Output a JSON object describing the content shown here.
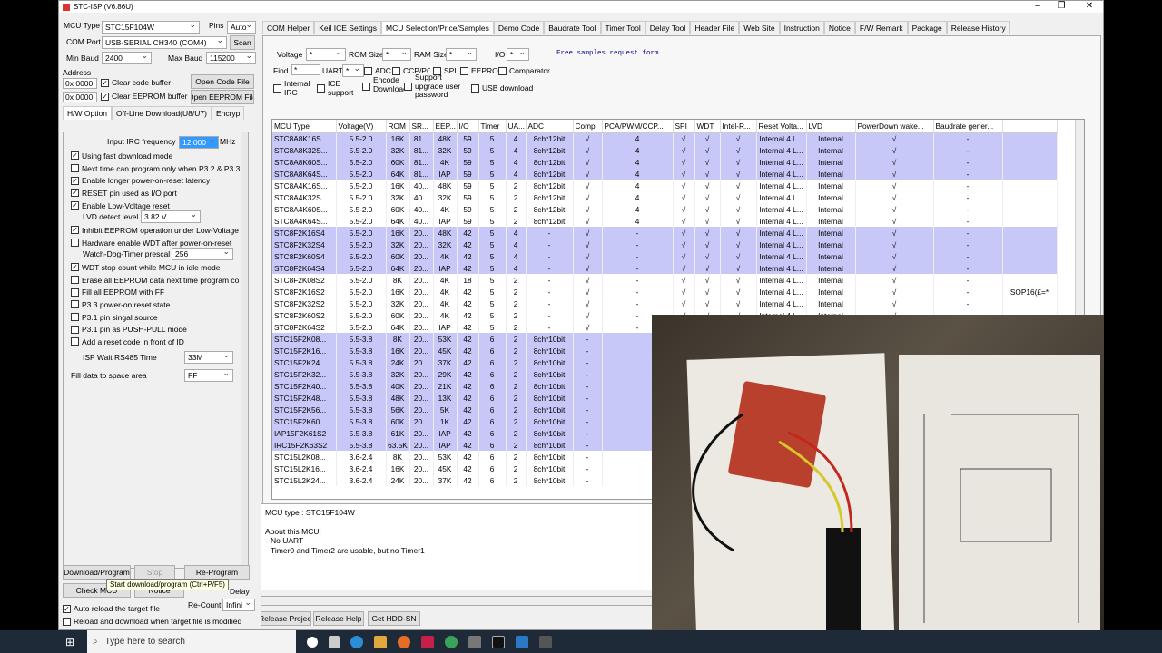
{
  "window": {
    "title": "STC-ISP (V6.86U)"
  },
  "left": {
    "mcu_type_label": "MCU Type",
    "mcu_type": "STC15F104W",
    "pins_label": "Pins",
    "pins": "Auto",
    "com_port_label": "COM Port",
    "com_port": "USB-SERIAL CH340 (COM4)",
    "scan": "Scan",
    "min_baud_label": "Min Baud",
    "min_baud": "2400",
    "max_baud_label": "Max Baud",
    "max_baud": "115200",
    "address_label": "Address",
    "addr1": "0x 0000",
    "addr2": "0x 0000",
    "clear_code_buffer": "Clear code buffer",
    "clear_eeprom_buffer": "Clear EEPROM buffer",
    "open_code_file": "Open Code File",
    "open_eeprom_file": "Open EEPROM File",
    "tabs": [
      "H/W Option",
      "Off-Line Download(U8/U7)",
      "Encryp"
    ],
    "irc_label": "Input IRC frequency",
    "irc_value": "12.000",
    "irc_unit": "MHz",
    "options": [
      {
        "text": "Using fast download mode",
        "checked": true
      },
      {
        "text": "Next time can program only when P3.2 & P3.3",
        "checked": false
      },
      {
        "text": "Enable longer power-on-reset latency",
        "checked": true
      },
      {
        "text": "RESET pin used as I/O port",
        "checked": true
      },
      {
        "text": "Enable Low-Voltage reset",
        "checked": true
      }
    ],
    "lvd_label": "LVD detect level",
    "lvd_value": "3.82 V",
    "options2": [
      {
        "text": "Inhibit EEPROM operation under Low-Voltage",
        "checked": true
      },
      {
        "text": "Hardware enable WDT after power-on-reset",
        "checked": false
      }
    ],
    "wdt_label": "Watch-Dog-Timer prescal",
    "wdt_value": "256",
    "options3": [
      {
        "text": "WDT stop count while MCU in idle mode",
        "checked": true
      },
      {
        "text": "Erase all EEPROM data next time program co",
        "checked": false
      },
      {
        "text": "Fill all EEPROM with FF",
        "checked": false
      },
      {
        "text": "P3.3 power-on reset state",
        "checked": false
      },
      {
        "text": "P3.1 pin singal source",
        "checked": false
      },
      {
        "text": "P3.1 pin as PUSH-PULL mode",
        "checked": false
      },
      {
        "text": "Add a reset code in front of ID",
        "checked": false
      }
    ],
    "isp_wait_label": "ISP Wait RS485 Time",
    "isp_wait_value": "33M",
    "fill_label": "Fill data to space area",
    "fill_value": "FF",
    "download_program": "Download/Program",
    "stop": "Stop",
    "re_program": "Re-Program",
    "check_mcu": "Check MCU",
    "notice": "Notice",
    "delay": "Delay",
    "tooltip": "Start download/program (Ctrl+P/F5)",
    "re_count_label": "Re-Count",
    "re_count_value": "Infini",
    "auto_reload": "Auto reload the target file",
    "reload_download": "Reload and download when target file is modified"
  },
  "right": {
    "tabs": [
      "COM Helper",
      "Keil ICE Settings",
      "MCU Selection/Price/Samples",
      "Demo Code",
      "Baudrate Tool",
      "Timer Tool",
      "Delay Tool",
      "Header File",
      "Web Site",
      "Instruction",
      "Notice",
      "F/W Remark",
      "Package",
      "Release History"
    ],
    "filters": {
      "voltage": "Voltage",
      "rom_size": "ROM Size",
      "ram_size": "RAM Size",
      "io": "I/O",
      "find": "Find",
      "find_value": "*",
      "uart": "UART",
      "star": "*",
      "adc": "ADC",
      "ccp_pca": "CCP/PCA",
      "spi": "SPI",
      "eeprom": "EEPROM",
      "comparator": "Comparator",
      "internal_irc": "Internal IRC",
      "ice_support": "ICE support",
      "encode_download": "Encode Download",
      "support_upgrade": "Support upgrade user password",
      "usb_download": "USB download",
      "free_samples": "Free samples request form"
    },
    "columns": [
      "MCU Type",
      "Voltage(V)",
      "ROM",
      "SR...",
      "EEP...",
      "I/O",
      "Timer",
      "UA...",
      "ADC",
      "Comp",
      "PCA/PWM/CCP...",
      "SPI",
      "WDT",
      "Intel-R...",
      "Reset Volta...",
      "LVD",
      "PowerDown wake...",
      "Baudrate gener..."
    ],
    "rows": [
      [
        "STC8A8K16S...",
        "5.5-2.0",
        "16K",
        "81...",
        "48K",
        "59",
        "5",
        "4",
        "8ch*12bit",
        "√",
        "4",
        "√",
        "√",
        "√",
        "Internal 4 L...",
        "Internal",
        "√",
        "-",
        ""
      ],
      [
        "STC8A8K32S...",
        "5.5-2.0",
        "32K",
        "81...",
        "32K",
        "59",
        "5",
        "4",
        "8ch*12bit",
        "√",
        "4",
        "√",
        "√",
        "√",
        "Internal 4 L...",
        "Internal",
        "√",
        "-",
        ""
      ],
      [
        "STC8A8K60S...",
        "5.5-2.0",
        "60K",
        "81...",
        "4K",
        "59",
        "5",
        "4",
        "8ch*12bit",
        "√",
        "4",
        "√",
        "√",
        "√",
        "Internal 4 L...",
        "Internal",
        "√",
        "-",
        ""
      ],
      [
        "STC8A8K64S...",
        "5.5-2.0",
        "64K",
        "81...",
        "IAP",
        "59",
        "5",
        "4",
        "8ch*12bit",
        "√",
        "4",
        "√",
        "√",
        "√",
        "Internal 4 L...",
        "Internal",
        "√",
        "-",
        ""
      ],
      [
        "STC8A4K16S...",
        "5.5-2.0",
        "16K",
        "40...",
        "48K",
        "59",
        "5",
        "2",
        "8ch*12bit",
        "√",
        "4",
        "√",
        "√",
        "√",
        "Internal 4 L...",
        "Internal",
        "√",
        "-",
        ""
      ],
      [
        "STC8A4K32S...",
        "5.5-2.0",
        "32K",
        "40...",
        "32K",
        "59",
        "5",
        "2",
        "8ch*12bit",
        "√",
        "4",
        "√",
        "√",
        "√",
        "Internal 4 L...",
        "Internal",
        "√",
        "-",
        ""
      ],
      [
        "STC8A4K60S...",
        "5.5-2.0",
        "60K",
        "40...",
        "4K",
        "59",
        "5",
        "2",
        "8ch*12bit",
        "√",
        "4",
        "√",
        "√",
        "√",
        "Internal 4 L...",
        "Internal",
        "√",
        "-",
        ""
      ],
      [
        "STC8A4K64S...",
        "5.5-2.0",
        "64K",
        "40...",
        "IAP",
        "59",
        "5",
        "2",
        "8ch*12bit",
        "√",
        "4",
        "√",
        "√",
        "√",
        "Internal 4 L...",
        "Internal",
        "√",
        "-",
        ""
      ],
      [
        "STC8F2K16S4",
        "5.5-2.0",
        "16K",
        "20...",
        "48K",
        "42",
        "5",
        "4",
        "-",
        "√",
        "-",
        "√",
        "√",
        "√",
        "Internal 4 L...",
        "Internal",
        "√",
        "-",
        ""
      ],
      [
        "STC8F2K32S4",
        "5.5-2.0",
        "32K",
        "20...",
        "32K",
        "42",
        "5",
        "4",
        "-",
        "√",
        "-",
        "√",
        "√",
        "√",
        "Internal 4 L...",
        "Internal",
        "√",
        "-",
        ""
      ],
      [
        "STC8F2K60S4",
        "5.5-2.0",
        "60K",
        "20...",
        "4K",
        "42",
        "5",
        "4",
        "-",
        "√",
        "-",
        "√",
        "√",
        "√",
        "Internal 4 L...",
        "Internal",
        "√",
        "-",
        ""
      ],
      [
        "STC8F2K64S4",
        "5.5-2.0",
        "64K",
        "20...",
        "IAP",
        "42",
        "5",
        "4",
        "-",
        "√",
        "-",
        "√",
        "√",
        "√",
        "Internal 4 L...",
        "Internal",
        "√",
        "-",
        ""
      ],
      [
        "STC8F2K08S2",
        "5.5-2.0",
        "8K",
        "20...",
        "4K",
        "18",
        "5",
        "2",
        "-",
        "√",
        "-",
        "√",
        "√",
        "√",
        "Internal 4 L...",
        "Internal",
        "√",
        "-",
        ""
      ],
      [
        "STC8F2K16S2",
        "5.5-2.0",
        "16K",
        "20...",
        "4K",
        "42",
        "5",
        "2",
        "-",
        "√",
        "-",
        "√",
        "√",
        "√",
        "Internal 4 L...",
        "Internal",
        "√",
        "-",
        "SOP16(£=*"
      ],
      [
        "STC8F2K32S2",
        "5.5-2.0",
        "32K",
        "20...",
        "4K",
        "42",
        "5",
        "2",
        "-",
        "√",
        "-",
        "√",
        "√",
        "√",
        "Internal 4 L...",
        "Internal",
        "√",
        "-",
        ""
      ],
      [
        "STC8F2K60S2",
        "5.5-2.0",
        "60K",
        "20...",
        "4K",
        "42",
        "5",
        "2",
        "-",
        "√",
        "-",
        "√",
        "√",
        "√",
        "Internal 4 L...",
        "Internal",
        "√",
        "-",
        ""
      ],
      [
        "STC8F2K64S2",
        "5.5-2.0",
        "64K",
        "20...",
        "IAP",
        "42",
        "5",
        "2",
        "-",
        "√",
        "-",
        "√",
        "√",
        "√",
        "Internal 4 L...",
        "Internal",
        "√",
        "-",
        ""
      ],
      [
        "STC15F2K08...",
        "5.5-3.8",
        "8K",
        "20...",
        "53K",
        "42",
        "6",
        "2",
        "8ch*10bit",
        "-",
        "",
        "",
        "",
        "",
        "",
        "",
        "",
        "",
        ""
      ],
      [
        "STC15F2K16...",
        "5.5-3.8",
        "16K",
        "20...",
        "45K",
        "42",
        "6",
        "2",
        "8ch*10bit",
        "-",
        "",
        "",
        "",
        "",
        "",
        "",
        "",
        "",
        ""
      ],
      [
        "STC15F2K24...",
        "5.5-3.8",
        "24K",
        "20...",
        "37K",
        "42",
        "6",
        "2",
        "8ch*10bit",
        "-",
        "",
        "",
        "",
        "",
        "",
        "",
        "",
        "",
        ""
      ],
      [
        "STC15F2K32...",
        "5.5-3.8",
        "32K",
        "20...",
        "29K",
        "42",
        "6",
        "2",
        "8ch*10bit",
        "-",
        "",
        "",
        "",
        "",
        "",
        "",
        "",
        "",
        ""
      ],
      [
        "STC15F2K40...",
        "5.5-3.8",
        "40K",
        "20...",
        "21K",
        "42",
        "6",
        "2",
        "8ch*10bit",
        "-",
        "",
        "",
        "",
        "",
        "",
        "",
        "",
        "",
        ""
      ],
      [
        "STC15F2K48...",
        "5.5-3.8",
        "48K",
        "20...",
        "13K",
        "42",
        "6",
        "2",
        "8ch*10bit",
        "-",
        "",
        "",
        "",
        "",
        "",
        "",
        "",
        "",
        ""
      ],
      [
        "STC15F2K56...",
        "5.5-3.8",
        "56K",
        "20...",
        "5K",
        "42",
        "6",
        "2",
        "8ch*10bit",
        "-",
        "",
        "",
        "",
        "",
        "",
        "",
        "",
        "",
        ""
      ],
      [
        "STC15F2K60...",
        "5.5-3.8",
        "60K",
        "20...",
        "1K",
        "42",
        "6",
        "2",
        "8ch*10bit",
        "-",
        "",
        "",
        "",
        "",
        "",
        "",
        "",
        "",
        ""
      ],
      [
        "IAP15F2K61S2",
        "5.5-3.8",
        "61K",
        "20...",
        "IAP",
        "42",
        "6",
        "2",
        "8ch*10bit",
        "-",
        "",
        "",
        "",
        "",
        "",
        "",
        "",
        "",
        ""
      ],
      [
        "IRC15F2K63S2",
        "5.5-3.8",
        "63.5K",
        "20...",
        "IAP",
        "42",
        "6",
        "2",
        "8ch*10bit",
        "-",
        "",
        "",
        "",
        "",
        "",
        "",
        "",
        "",
        ""
      ],
      [
        "STC15L2K08...",
        "3.6-2.4",
        "8K",
        "20...",
        "53K",
        "42",
        "6",
        "2",
        "8ch*10bit",
        "-",
        "",
        "",
        "",
        "",
        "",
        "",
        "",
        "",
        ""
      ],
      [
        "STC15L2K16...",
        "3.6-2.4",
        "16K",
        "20...",
        "45K",
        "42",
        "6",
        "2",
        "8ch*10bit",
        "-",
        "",
        "",
        "",
        "",
        "",
        "",
        "",
        "",
        ""
      ],
      [
        "STC15L2K24...",
        "3.6-2.4",
        "24K",
        "20...",
        "37K",
        "42",
        "6",
        "2",
        "8ch*10bit",
        "-",
        "",
        "",
        "",
        "",
        "",
        "",
        "",
        "",
        ""
      ]
    ],
    "highlight_rows": [
      0,
      1,
      2,
      3,
      8,
      9,
      10,
      11,
      17,
      18,
      19,
      20,
      21,
      22,
      23,
      24,
      25,
      26
    ],
    "info": {
      "mcu_type": "MCU type : STC15F104W",
      "about": "About this MCU:",
      "line1": "No UART",
      "line2": "Timer0 and Timer2 are usable, but no Timer1"
    },
    "bottom_buttons": [
      "Release Project",
      "Release Help",
      "Get HDD-SN"
    ]
  },
  "taskbar": {
    "search_placeholder": "Type here to search"
  }
}
